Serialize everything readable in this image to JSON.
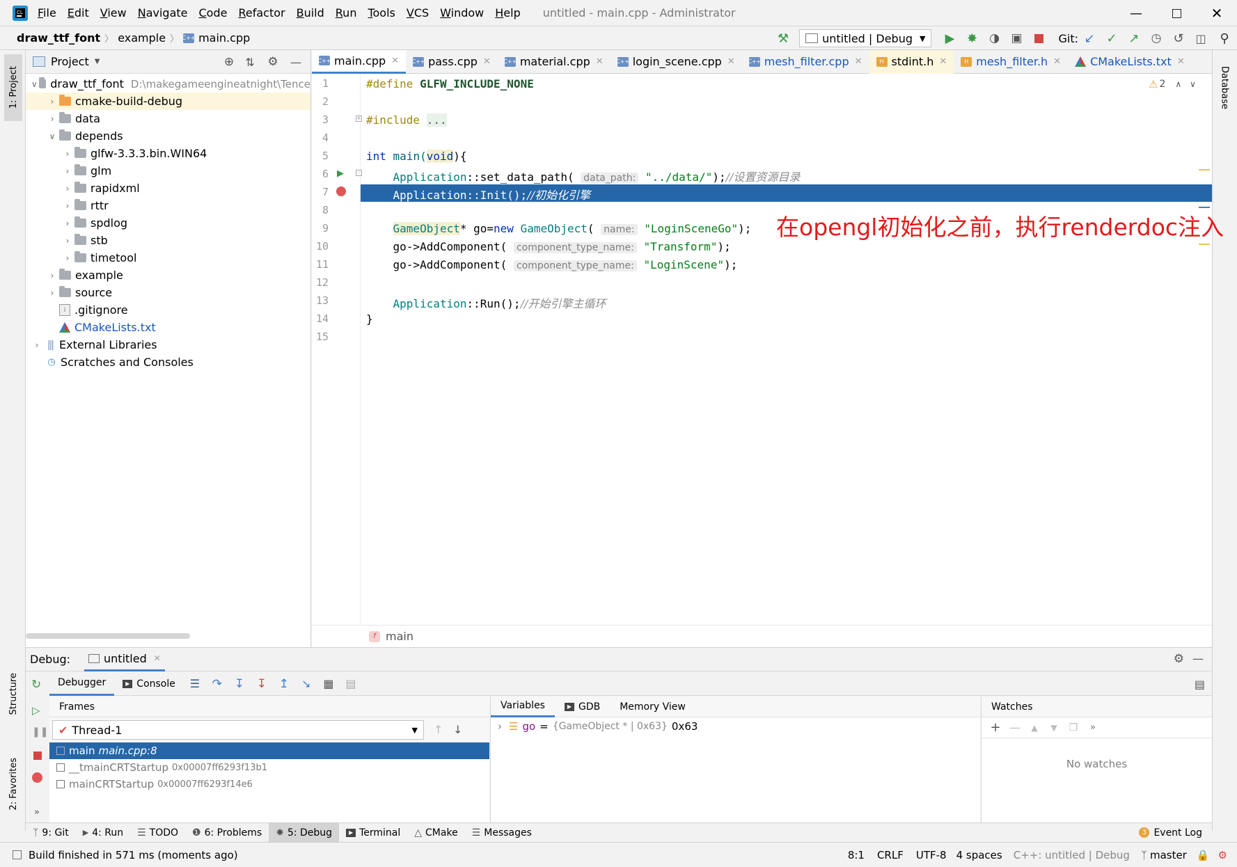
{
  "window": {
    "title": "untitled - main.cpp - Administrator",
    "menu": [
      "File",
      "Edit",
      "View",
      "Navigate",
      "Code",
      "Refactor",
      "Build",
      "Run",
      "Tools",
      "VCS",
      "Window",
      "Help"
    ]
  },
  "navbar": {
    "crumbs": [
      "draw_ttf_font",
      "example",
      "main.cpp"
    ],
    "run_config": "untitled | Debug",
    "git_label": "Git:"
  },
  "left_strip": {
    "project_tab": "1: Project",
    "structure_tab": "Structure",
    "favorites_tab": "2: Favorites"
  },
  "right_strip": {
    "database_tab": "Database"
  },
  "project": {
    "header": "Project",
    "tree": [
      {
        "label": "draw_ttf_font",
        "path": "D:\\makegameengineatnight\\Tence",
        "depth": 0,
        "open": true,
        "kind": "folder"
      },
      {
        "label": "cmake-build-debug",
        "depth": 1,
        "open": false,
        "kind": "folder-orange"
      },
      {
        "label": "data",
        "depth": 1,
        "open": false,
        "kind": "folder"
      },
      {
        "label": "depends",
        "depth": 1,
        "open": true,
        "kind": "folder"
      },
      {
        "label": "glfw-3.3.3.bin.WIN64",
        "depth": 2,
        "open": false,
        "kind": "folder"
      },
      {
        "label": "glm",
        "depth": 2,
        "open": false,
        "kind": "folder"
      },
      {
        "label": "rapidxml",
        "depth": 2,
        "open": false,
        "kind": "folder"
      },
      {
        "label": "rttr",
        "depth": 2,
        "open": false,
        "kind": "folder"
      },
      {
        "label": "spdlog",
        "depth": 2,
        "open": false,
        "kind": "folder"
      },
      {
        "label": "stb",
        "depth": 2,
        "open": false,
        "kind": "folder"
      },
      {
        "label": "timetool",
        "depth": 2,
        "open": false,
        "kind": "folder"
      },
      {
        "label": "example",
        "depth": 1,
        "open": false,
        "kind": "folder"
      },
      {
        "label": "source",
        "depth": 1,
        "open": false,
        "kind": "folder"
      },
      {
        "label": ".gitignore",
        "depth": 1,
        "kind": "file"
      },
      {
        "label": "CMakeLists.txt",
        "depth": 1,
        "kind": "cmake"
      },
      {
        "label": "External Libraries",
        "depth": 0,
        "open": false,
        "kind": "libs"
      },
      {
        "label": "Scratches and Consoles",
        "depth": 0,
        "kind": "scratch"
      }
    ]
  },
  "tabs": [
    {
      "label": "main.cpp",
      "type": "cpp",
      "active": true
    },
    {
      "label": "pass.cpp",
      "type": "cpp"
    },
    {
      "label": "material.cpp",
      "type": "cpp"
    },
    {
      "label": "login_scene.cpp",
      "type": "cpp"
    },
    {
      "label": "mesh_filter.cpp",
      "type": "cpp"
    },
    {
      "label": "stdint.h",
      "type": "h"
    },
    {
      "label": "mesh_filter.h",
      "type": "h"
    },
    {
      "label": "CMakeLists.txt",
      "type": "cmake"
    }
  ],
  "editor": {
    "warning_count": "2",
    "line_numbers": [
      "1",
      "2",
      "3",
      "4",
      "5",
      "6",
      "7",
      "8",
      "9",
      "10",
      "11",
      "12",
      "13",
      "14",
      "15"
    ],
    "annotation": "在opengl初始化之前，执行renderdoc注入",
    "breadcrumb": "main",
    "code": {
      "l1_kw": "#define",
      "l1_name": " GLFW_INCLUDE_NONE",
      "l3_kw": "#include",
      "l3_fold": "...",
      "l6_int": "int",
      "l6_main": " main(",
      "l6_void": "void",
      "l6_end": "){",
      "l7_cls": "Application",
      "l7_fn": "::set_data_path(",
      "l7_hint": "data_path:",
      "l7_str": "\"../data/\"",
      "l7_end": ");",
      "l7_cmt": "//设置资源目录",
      "l8_text": "Application::Init();",
      "l8_cmt": "//初始化引擎",
      "l10_cls": "GameObject",
      "l10_a": "* go=",
      "l10_new": "new",
      "l10_cls2": "GameObject",
      "l10_b": "(",
      "l10_hint": "name:",
      "l10_str": "\"LoginSceneGo\"",
      "l10_end": ");",
      "l11_a": "go->AddComponent(",
      "l11_hint": "component_type_name:",
      "l11_str": "\"Transform\"",
      "l11_end": ");",
      "l12_a": "go->AddComponent(",
      "l12_hint": "component_type_name:",
      "l12_str": "\"LoginScene\"",
      "l12_end": ");",
      "l14_cls": "Application",
      "l14_fn": "::Run();",
      "l14_cmt": "//开始引擎主循环",
      "l15": "}"
    }
  },
  "debug": {
    "label": "Debug:",
    "session": "untitled",
    "tabs": {
      "debugger": "Debugger",
      "console": "Console"
    },
    "frames_title": "Frames",
    "thread": "Thread-1",
    "frames": [
      {
        "name": "main",
        "loc": "main.cpp:8",
        "selected": true
      },
      {
        "name": "__tmainCRTStartup",
        "loc": "0x00007ff6293f13b1"
      },
      {
        "name": "mainCRTStartup",
        "loc": "0x00007ff6293f14e6"
      }
    ],
    "variables_tabs": {
      "variables": "Variables",
      "gdb": "GDB",
      "memory": "Memory View"
    },
    "variable": {
      "name": "go",
      "eq": "=",
      "type": "{GameObject * | 0x63}",
      "value": "0x63"
    },
    "watches_title": "Watches",
    "no_watches": "No watches"
  },
  "toolwindows": [
    {
      "label": "9: Git"
    },
    {
      "label": "4: Run"
    },
    {
      "label": "TODO"
    },
    {
      "label": "6: Problems"
    },
    {
      "label": "5: Debug",
      "active": true
    },
    {
      "label": "Terminal"
    },
    {
      "label": "CMake"
    },
    {
      "label": "Messages"
    }
  ],
  "event_log": {
    "count": "3",
    "label": "Event Log"
  },
  "status": {
    "message": "Build finished in 571 ms (moments ago)",
    "position": "8:1",
    "line_sep": "CRLF",
    "encoding": "UTF-8",
    "indent": "4 spaces",
    "context": "C++: untitled | Debug",
    "branch": "master"
  },
  "colors": {
    "accent": "#2566a8",
    "annotation": "#e31a1a",
    "run_green": "#3a9a4a",
    "stop_red": "#d64545"
  }
}
